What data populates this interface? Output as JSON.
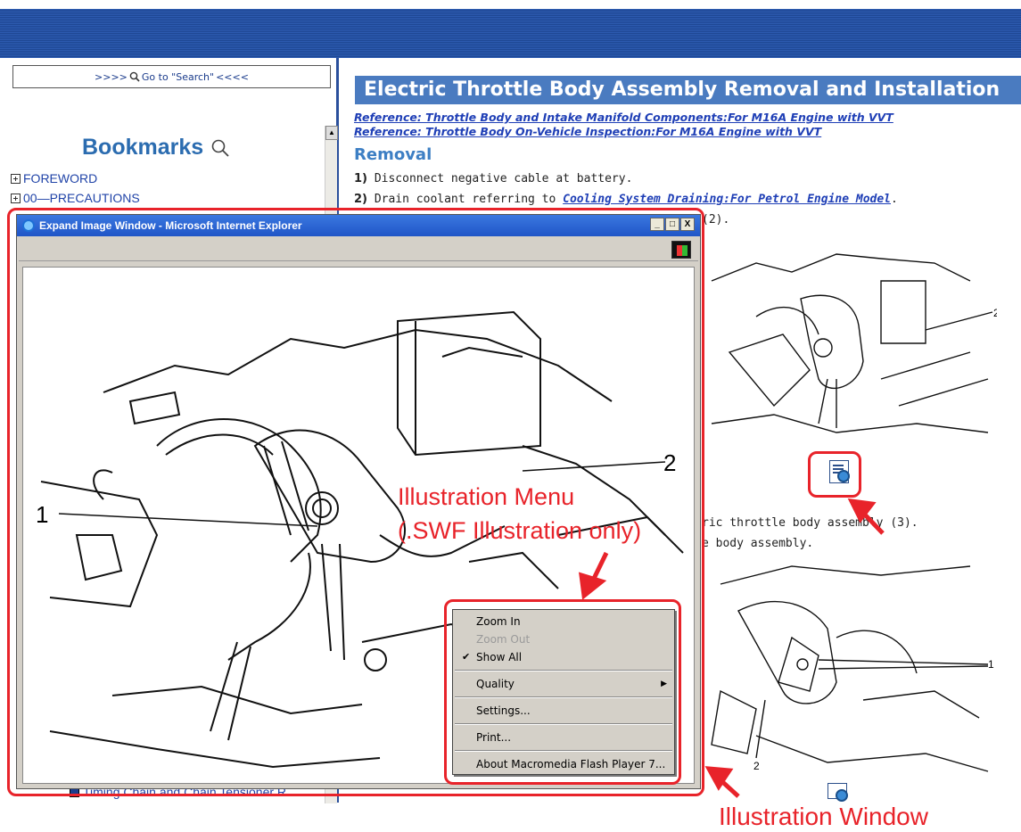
{
  "left_pane": {
    "goto_search": "Go to \"Search\"",
    "goto_prefix": ">>>>",
    "goto_suffix": "<<<<",
    "bookmarks_title": "Bookmarks",
    "tree_items": [
      "FOREWORD",
      "00—PRECAUTIONS"
    ],
    "bottom_item": "Timing Chain and Chain Tensioner R"
  },
  "content": {
    "title": "Electric Throttle Body Assembly Removal and Installation",
    "references": [
      "Reference: Throttle Body and Intake Manifold Components:For M16A Engine with VVT",
      "Reference: Throttle Body On-Vehicle Inspection:For M16A Engine with VVT"
    ],
    "section": "Removal",
    "steps": [
      {
        "num": "1)",
        "text": "Disconnect negative cable at battery.",
        "link": ""
      },
      {
        "num": "2)",
        "text": "Drain coolant referring to ",
        "link": "Cooling System Draining:For Petrol Engine Model",
        "tail": "."
      }
    ],
    "fragment_1": "(2).",
    "fragment_2": "ric throttle body assembly (3).",
    "fragment_3": "e body assembly.",
    "callouts": {
      "a": "2",
      "b": "1",
      "c": "2"
    }
  },
  "popup": {
    "title": "Expand Image Window - Microsoft Internet Explorer",
    "buttons": {
      "minimize": "_",
      "maximize": "□",
      "close": "X"
    },
    "callout_1": "1",
    "callout_2": "2"
  },
  "context_menu": {
    "items": [
      {
        "label": "Zoom In",
        "disabled": false
      },
      {
        "label": "Zoom Out",
        "disabled": true
      },
      {
        "label": "Show All",
        "checked": true
      },
      {
        "label": "Quality",
        "submenu": true
      },
      {
        "label": "Settings..."
      },
      {
        "label": "Print..."
      },
      {
        "label": "About Macromedia Flash Player 7..."
      }
    ]
  },
  "annotations": {
    "menu_label_1": "Illustration Menu",
    "menu_label_2": "(.SWF Illustration only)",
    "window_label": "Illustration Window",
    "color": "#e8232a"
  }
}
